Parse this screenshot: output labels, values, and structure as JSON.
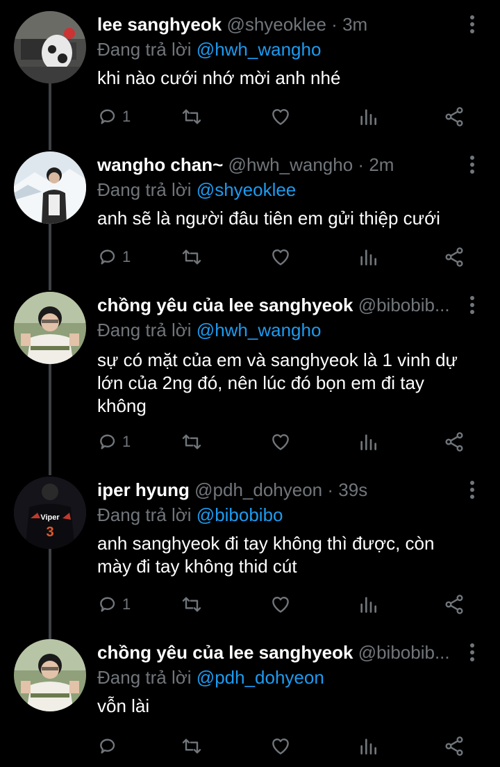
{
  "reply_prefix": "Đang trả lời",
  "tweets": [
    {
      "name": "lee sanghyeok",
      "handle": "@shyeoklee",
      "separator": "·",
      "time": "3m",
      "replying_to": "@hwh_wangho",
      "text": "khi nào cưới nhớ mời anh nhé",
      "reply_count": "1",
      "avatar": "avatar-lee-sanghyeok"
    },
    {
      "name": "wangho chan~",
      "handle": "@hwh_wangho",
      "separator": "·",
      "time": "2m",
      "replying_to": "@shyeoklee",
      "text": "anh sẽ là người đâu tiên em gửi thiệp cưới",
      "reply_count": "1",
      "avatar": "avatar-wangho"
    },
    {
      "name": "chồng yêu của lee sanghyeok",
      "handle": "@bibobib...",
      "separator": "",
      "time": "",
      "replying_to": "@hwh_wangho",
      "text": "sự có mặt của em và sanghyeok là 1 vinh dự lớn của 2ng đó, nên lúc đó bọn em đi tay không",
      "reply_count": "1",
      "avatar": "avatar-bibobibo"
    },
    {
      "name": "iper hyung",
      "handle": "@pdh_dohyeon",
      "separator": "·",
      "time": "39s",
      "replying_to": "@bibobibo",
      "text": "anh sanghyeok đi tay không thì được, còn mày đi tay không thid cút",
      "reply_count": "1",
      "avatar": "avatar-viper"
    },
    {
      "name": "chồng yêu của lee sanghyeok",
      "handle": "@bibobib...",
      "separator": "",
      "time": "",
      "replying_to": "@pdh_dohyeon",
      "text": "vỗn lài",
      "reply_count": "",
      "avatar": "avatar-bibobibo"
    }
  ],
  "colors": {
    "background": "#000000",
    "muted": "#71767b",
    "link": "#1d9bf0",
    "thread_line": "#3e4144"
  }
}
